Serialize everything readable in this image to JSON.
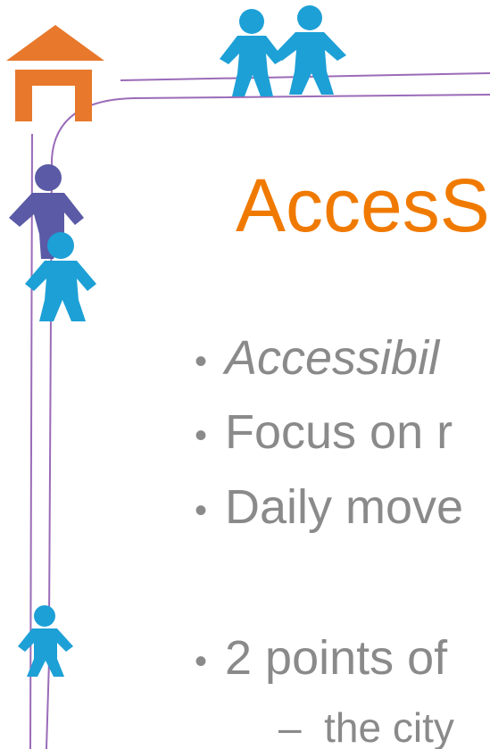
{
  "slide": {
    "title": "AccesS",
    "bullets": [
      {
        "text": "Accessibil",
        "italic": true
      },
      {
        "text": "Focus on r",
        "italic": false
      },
      {
        "text": "Daily move",
        "italic": false
      },
      {
        "text": "2 points of",
        "italic": false
      }
    ],
    "sub_bullet": {
      "dash": "–",
      "text": "the  city"
    }
  },
  "colors": {
    "title": "#f07a00",
    "house": "#e8782b",
    "person_blue": "#1da0d6",
    "person_purple": "#5a5aa6",
    "path": "#9b6bb8",
    "text": "#8a8a8a"
  }
}
